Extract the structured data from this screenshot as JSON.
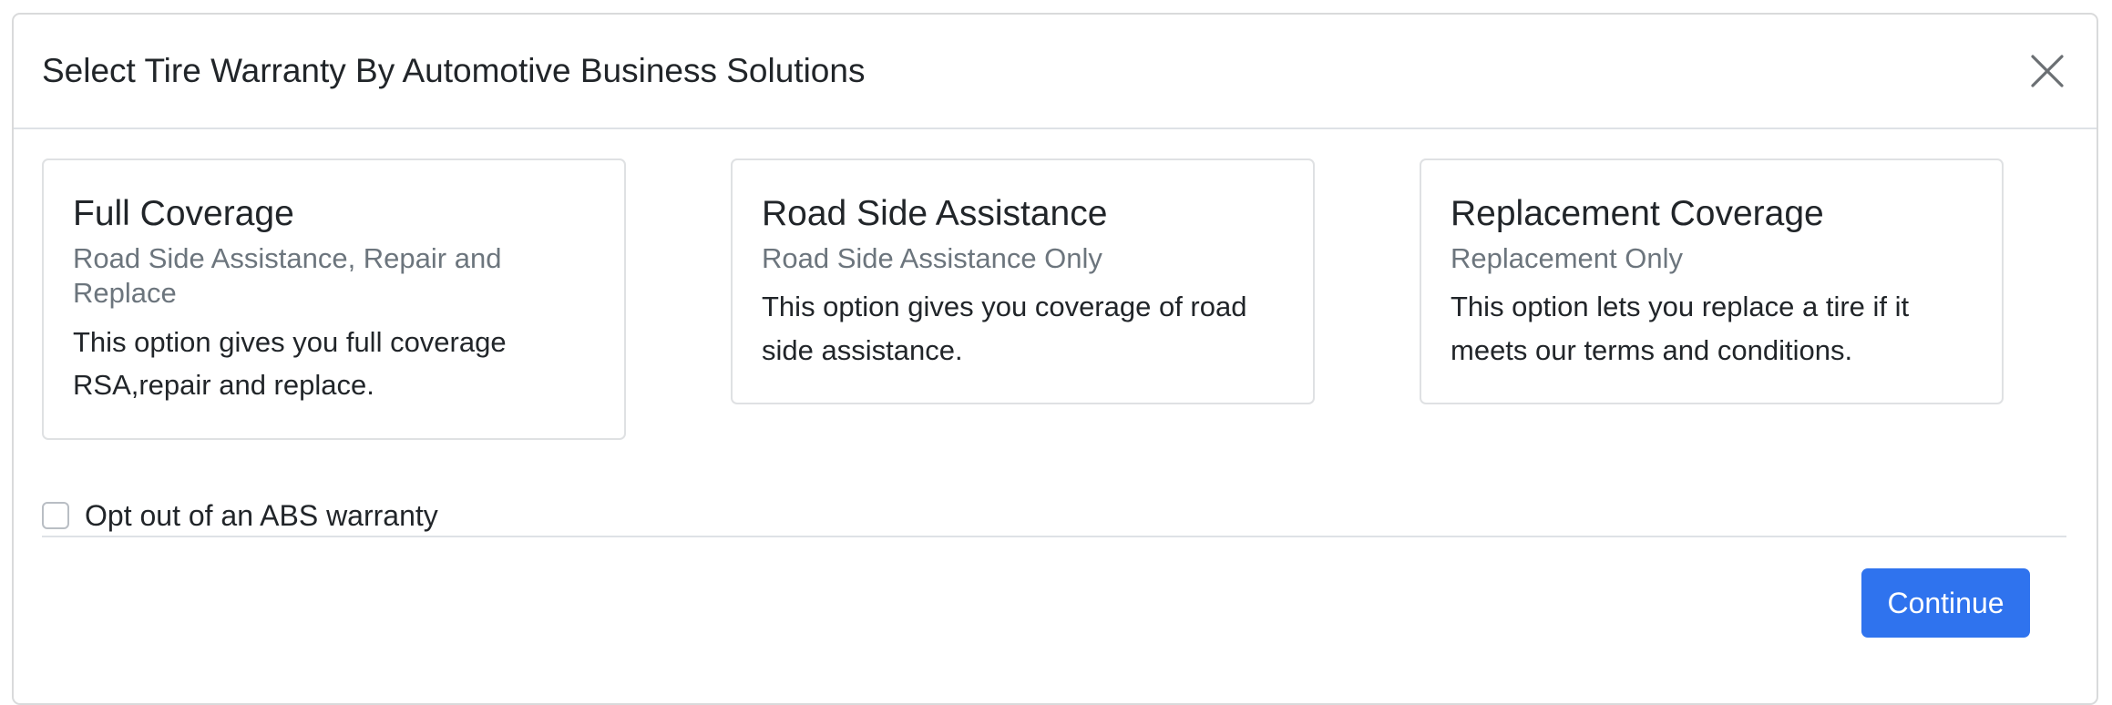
{
  "modal": {
    "title": "Select Tire Warranty By Automotive Business Solutions",
    "close_icon": "close-icon"
  },
  "cards": [
    {
      "title": "Full Coverage",
      "subtitle": "Road Side Assistance, Repair and Replace",
      "text": "This option gives you full coverage RSA,repair and replace."
    },
    {
      "title": "Road Side Assistance",
      "subtitle": "Road Side Assistance Only",
      "text": "This option gives you coverage of road side assistance."
    },
    {
      "title": "Replacement Coverage",
      "subtitle": "Replacement Only",
      "text": "This option lets you replace a tire if it meets our terms and conditions."
    }
  ],
  "opt_out": {
    "label": "Opt out of an ABS warranty",
    "checked": false
  },
  "footer": {
    "continue_label": "Continue"
  },
  "colors": {
    "primary": "#2f73ee",
    "muted_text": "#6c757d",
    "border": "#dee2e6"
  }
}
